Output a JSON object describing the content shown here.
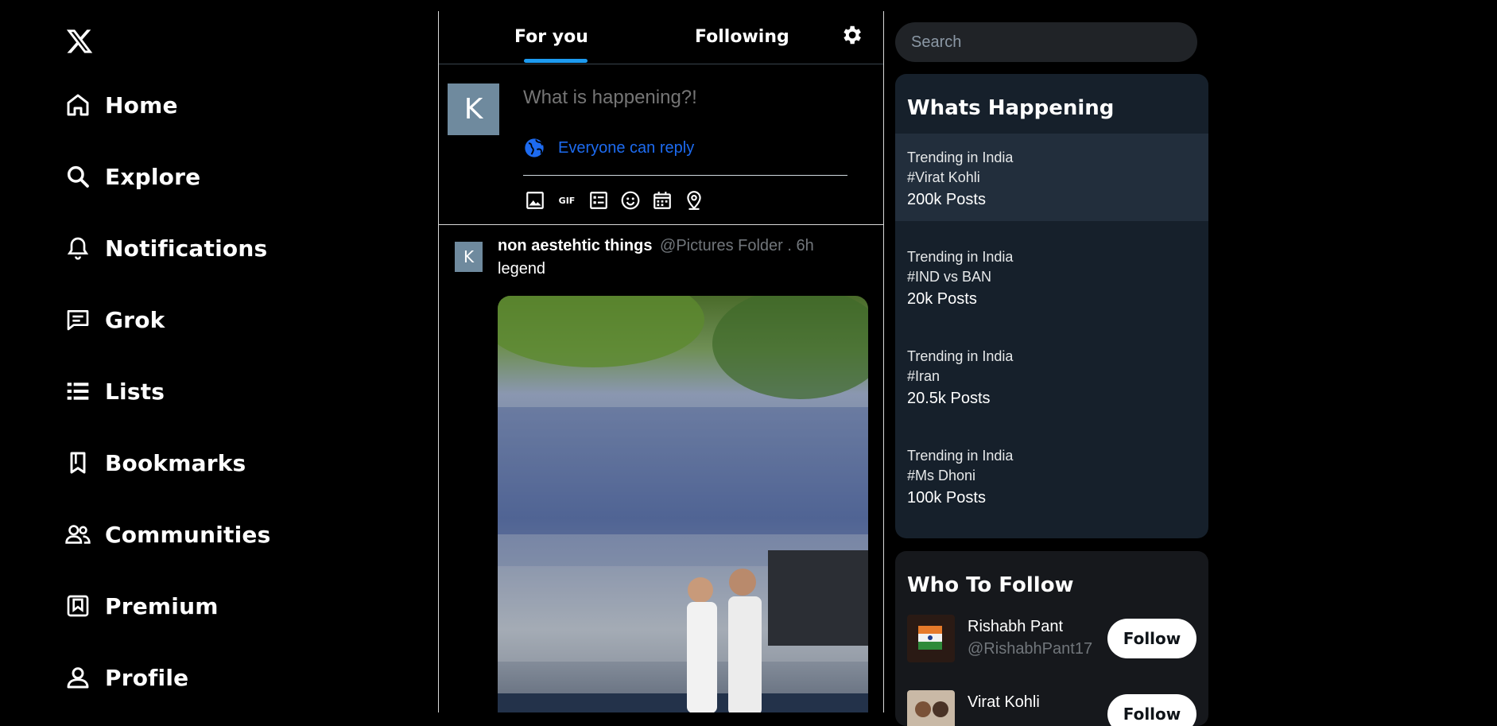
{
  "nav": {
    "items": [
      {
        "label": "Home",
        "icon": "home-icon"
      },
      {
        "label": "Explore",
        "icon": "search-icon"
      },
      {
        "label": "Notifications",
        "icon": "bell-icon"
      },
      {
        "label": "Grok",
        "icon": "grok-icon"
      },
      {
        "label": "Lists",
        "icon": "list-icon"
      },
      {
        "label": "Bookmarks",
        "icon": "bookmark-icon"
      },
      {
        "label": "Communities",
        "icon": "communities-icon"
      },
      {
        "label": "Premium",
        "icon": "premium-icon"
      },
      {
        "label": "Profile",
        "icon": "profile-icon"
      }
    ]
  },
  "tabs": {
    "for_you": "For you",
    "following": "Following",
    "active": "For you"
  },
  "composer": {
    "avatar_letter": "K",
    "placeholder": "What is happening?!",
    "reply_label": "Everyone can reply",
    "tools": [
      "image-icon",
      "gif-icon",
      "poll-icon",
      "emoji-icon",
      "schedule-icon",
      "location-icon"
    ],
    "gif_text": "GIF"
  },
  "tweet": {
    "avatar_letter": "K",
    "name": "non aestehtic things",
    "handle_time": "@Pictures Folder . 6h",
    "text": "legend"
  },
  "search": {
    "placeholder": "Search"
  },
  "happening": {
    "title": "Whats Happening",
    "trends": [
      {
        "context": "Trending in India",
        "tag": "#Virat Kohli",
        "posts": "200k Posts"
      },
      {
        "context": "Trending in India",
        "tag": "#IND vs BAN",
        "posts": "20k Posts"
      },
      {
        "context": "Trending in India",
        "tag": "#Iran",
        "posts": "20.5k Posts"
      },
      {
        "context": "Trending in India",
        "tag": "#Ms Dhoni",
        "posts": "100k Posts"
      }
    ]
  },
  "who_to_follow": {
    "title": "Who To Follow",
    "users": [
      {
        "name": "Rishabh Pant",
        "handle": "@RishabhPant17",
        "button": "Follow"
      },
      {
        "name": "Virat Kohli",
        "handle": "",
        "button": "Follow"
      }
    ]
  },
  "colors": {
    "accent": "#1d9bf0",
    "background": "#000000",
    "card": "#16202b"
  }
}
